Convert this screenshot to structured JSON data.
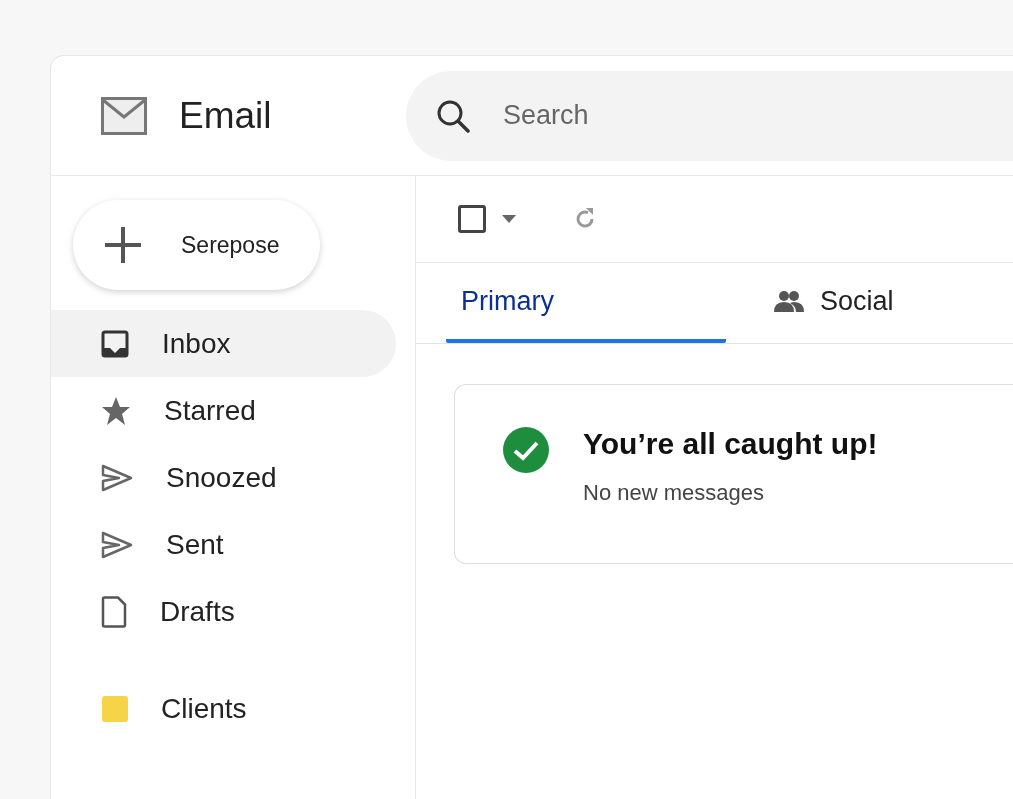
{
  "app": {
    "title": "Email"
  },
  "search": {
    "placeholder": "Search"
  },
  "compose": {
    "label": "Serepose"
  },
  "folders": [
    {
      "kind": "inbox",
      "label": "Inbox",
      "selected": true
    },
    {
      "kind": "star",
      "label": "Starred",
      "selected": false
    },
    {
      "kind": "send",
      "label": "Snoozed",
      "selected": false
    },
    {
      "kind": "send",
      "label": "Sent",
      "selected": false
    },
    {
      "kind": "file",
      "label": "Drafts",
      "selected": false
    }
  ],
  "labels": [
    {
      "label": "Clients",
      "color": "#f5d547"
    }
  ],
  "toolbar": {
    "select_all_checked": false
  },
  "tabs": [
    {
      "kind": "primary",
      "label": "Primary",
      "selected": true
    },
    {
      "kind": "social",
      "label": "Social",
      "selected": false
    }
  ],
  "empty_state": {
    "title": "You’re all caught up!",
    "message": "No new messages"
  }
}
